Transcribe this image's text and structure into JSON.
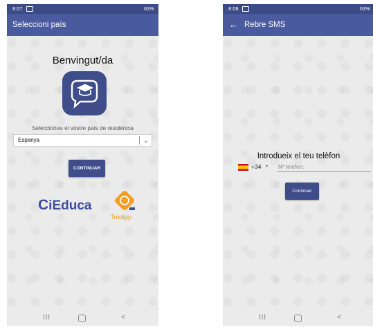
{
  "left_screen": {
    "status": {
      "time": "8:07",
      "right": "63%"
    },
    "appbar_title": "Seleccioni país",
    "welcome": "Benvingut/da",
    "select_label": "Seleccioneu el vostre país de residència",
    "country_value": "Espanya",
    "button_label": "CONTINUAR",
    "logos": {
      "ieduca_letter": "C",
      "ieduca_text": "iEduca",
      "tokapp": "TokApp"
    },
    "nav": {
      "recent": "III",
      "back": "<"
    }
  },
  "right_screen": {
    "status": {
      "time": "8:08",
      "right": "63%"
    },
    "appbar_title": "Rebre SMS",
    "back_glyph": "←",
    "heading": "Introdueix el teu telèfon",
    "dial_code": "+34",
    "dial_chevron": "▾",
    "phone_placeholder": "Nº telèfon:",
    "button_label": "Continuar",
    "nav": {
      "recent": "III",
      "back": "<"
    }
  },
  "colors": {
    "primary": "#3f4d8a",
    "appbar": "#4a5a9e",
    "accent": "#f59f1e"
  },
  "icons": [
    "graduation-cap-chat-icon",
    "back-arrow-icon",
    "chevron-down-icon",
    "spain-flag-icon"
  ]
}
